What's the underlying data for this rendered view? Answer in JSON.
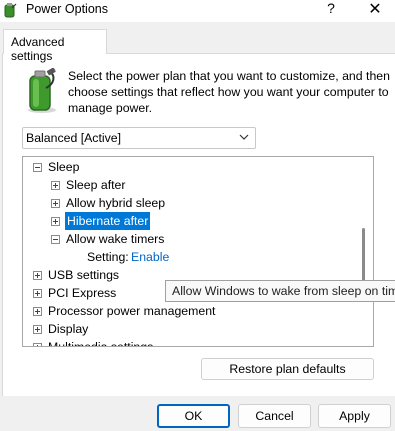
{
  "window": {
    "title": "Power Options",
    "help_label": "?",
    "close_label": "✕"
  },
  "tabs": [
    {
      "label": "Advanced settings",
      "active": true
    }
  ],
  "description": "Select the power plan that you want to customize, and then choose settings that reflect how you want your computer to manage power.",
  "plan_select": {
    "value": "Balanced [Active]"
  },
  "tree": {
    "items": [
      {
        "label": "Sleep",
        "expander": "minus",
        "level": 0
      },
      {
        "label": "Sleep after",
        "expander": "plus",
        "level": 1
      },
      {
        "label": "Allow hybrid sleep",
        "expander": "plus",
        "level": 1
      },
      {
        "label": "Hibernate after",
        "expander": "plus",
        "level": 1,
        "selected": true
      },
      {
        "label": "Allow wake timers",
        "expander": "minus",
        "level": 1
      },
      {
        "label": "Setting:",
        "value": "Enable",
        "level": 2
      },
      {
        "label": "USB settings",
        "expander": "plus",
        "level": 0
      },
      {
        "label": "PCI Express",
        "expander": "plus",
        "level": 0
      },
      {
        "label": "Processor power management",
        "expander": "plus",
        "level": 0
      },
      {
        "label": "Display",
        "expander": "plus",
        "level": 0
      },
      {
        "label": "Multimedia settings",
        "expander": "plus",
        "level": 0
      }
    ]
  },
  "tooltip": "Allow Windows to wake from sleep on timers",
  "buttons": {
    "restore": "Restore plan defaults",
    "ok": "OK",
    "cancel": "Cancel",
    "apply": "Apply"
  },
  "colors": {
    "selection": "#0078d7",
    "link_value": "#0066cc",
    "ok_border": "#0067c0"
  },
  "icons": {
    "app": "power-options-battery-icon",
    "plan_dropdown": "chevron-down-icon"
  }
}
